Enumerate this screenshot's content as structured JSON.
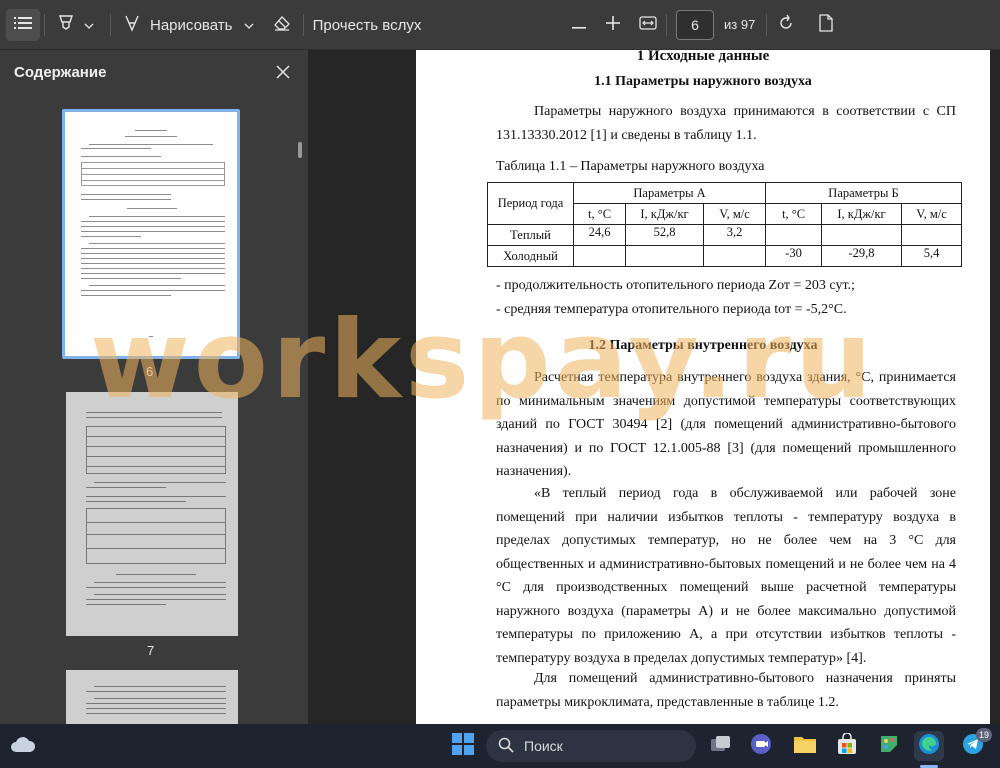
{
  "toolbar": {
    "draw_label": "Нарисовать",
    "read_aloud_label": "Прочесть вслух",
    "current_page": "6",
    "total_pages": "из 97"
  },
  "sidebar": {
    "title": "Содержание",
    "thumbnails": [
      {
        "page": "6"
      },
      {
        "page": "7"
      }
    ]
  },
  "document": {
    "h1": "1 Исходные данные",
    "h1_1": "1.1 Параметры наружного воздуха",
    "p1": "Параметры наружного воздуха принимаются в соответствии с СП 131.13330.2012 [1] и сведены в таблицу 1.1.",
    "table_caption": "Таблица 1.1 – Параметры наружного воздуха",
    "table": {
      "period_header": "Период года",
      "group_a": "Параметры А",
      "group_b": "Параметры Б",
      "sub_headers": [
        "t, °C",
        "I, кДж/кг",
        "V, м/с",
        "t, °C",
        "I, кДж/кг",
        "V, м/с"
      ],
      "rows": [
        {
          "period": "Теплый",
          "values": [
            "24,6",
            "52,8",
            "3,2",
            "",
            "",
            ""
          ]
        },
        {
          "period": "Холодный",
          "values": [
            "",
            "",
            "",
            "-30",
            "-29,8",
            "5,4"
          ]
        }
      ]
    },
    "dur_line": "- продолжительность отопительного периода Zот = 203 сут.;",
    "temp_line": "- средняя температура отопительного периода tот = -5,2°С.",
    "h1_2": "1.2 Параметры внутреннего воздуха",
    "p2": "Расчетная температура внутреннего воздуха здания, °С, принимается по минимальным значениям допустимой температуры соответствующих зданий по ГОСТ 30494 [2] (для помещений административно-бытового назначения) и по ГОСТ 12.1.005-88 [3] (для помещений промышленного назначения).",
    "p3": "«В теплый период года в обслуживаемой или рабочей зоне помещений при наличии избытков теплоты - температуру воздуха в пределах допустимых температур, но не более чем на 3 °С для общественных и административно-бытовых помещений и не более чем на 4 °С для производственных помещений выше расчетной температуры наружного воздуха (параметры А) и не более максимально допустимой температуры по приложению А, а при отсутствии избытков теплоты - температуру воздуха в пределах допустимых температур» [4].",
    "p4": "Для помещений административно-бытового назначения приняты параметры микроклимата, представленные в таблице 1.2."
  },
  "watermark": "workspay.ru",
  "taskbar": {
    "search_label": "Поиск",
    "telegram_badge": "19"
  }
}
